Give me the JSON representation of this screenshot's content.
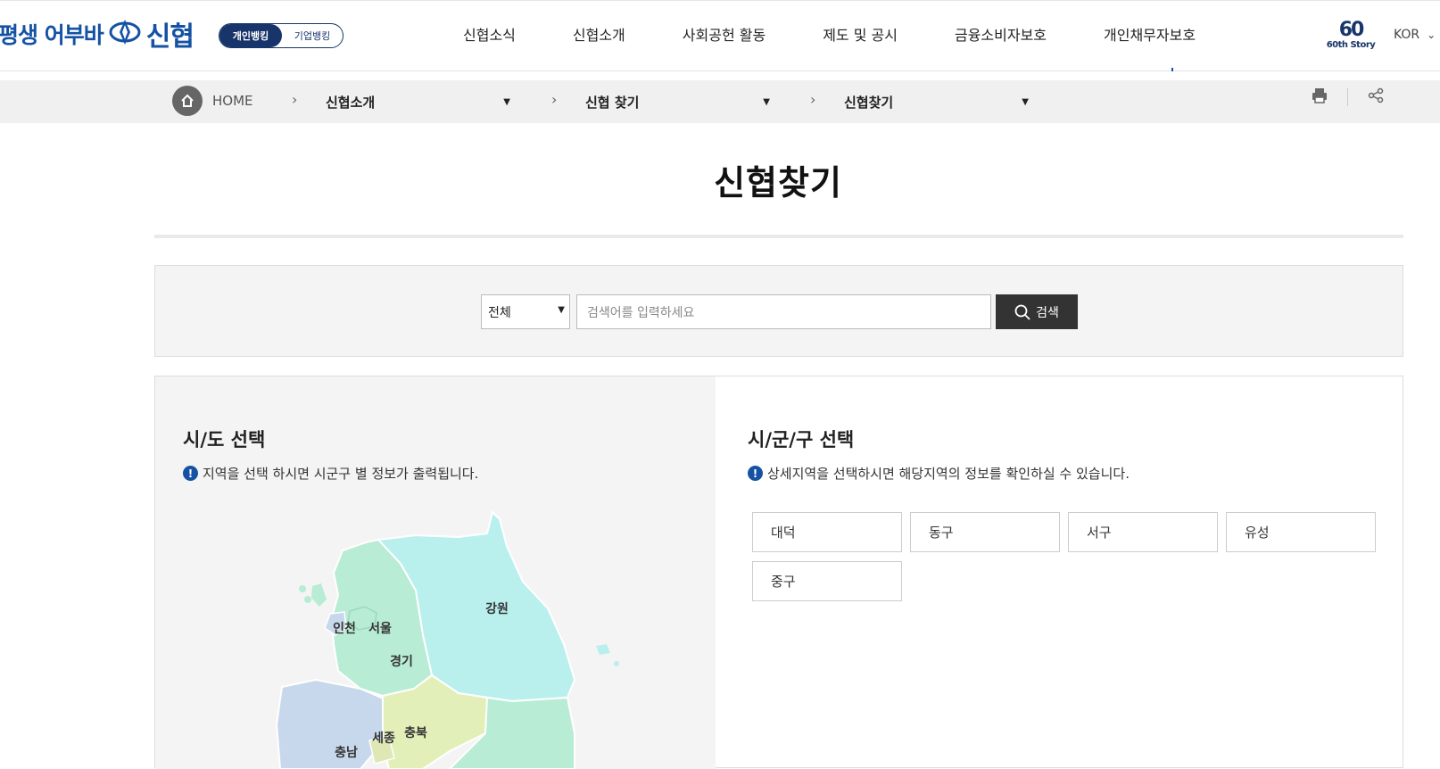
{
  "header": {
    "logo_text": "평생 어부바",
    "logo_brand": "신협",
    "banking_toggle": {
      "personal": "개인뱅킹",
      "corporate": "기업뱅킹"
    },
    "nav": [
      "신협소식",
      "신협소개",
      "사회공헌 활동",
      "제도 및 공시",
      "금융소비자보호",
      "개인채무자보호"
    ],
    "story": {
      "number": "60",
      "label": "60th Story"
    },
    "lang": "KOR"
  },
  "breadcrumb": {
    "home": "HOME",
    "level1": "신협소개",
    "level2": "신협 찾기",
    "level3": "신협찾기"
  },
  "page": {
    "title": "신협찾기"
  },
  "search": {
    "select_value": "전체",
    "placeholder": "검색어를 입력하세요",
    "button": "검색"
  },
  "left_panel": {
    "heading": "시/도 선택",
    "info": "지역을 선택 하시면 시군구 별 정보가 출력됩니다.",
    "map_labels": [
      "인천",
      "서울",
      "경기",
      "강원",
      "세종",
      "충북",
      "충남"
    ]
  },
  "right_panel": {
    "heading": "시/군/구 선택",
    "info": "상세지역을 선택하시면 해당지역의 정보를 확인하실 수 있습니다.",
    "districts": [
      "대덕",
      "동구",
      "서구",
      "유성",
      "중구"
    ]
  }
}
